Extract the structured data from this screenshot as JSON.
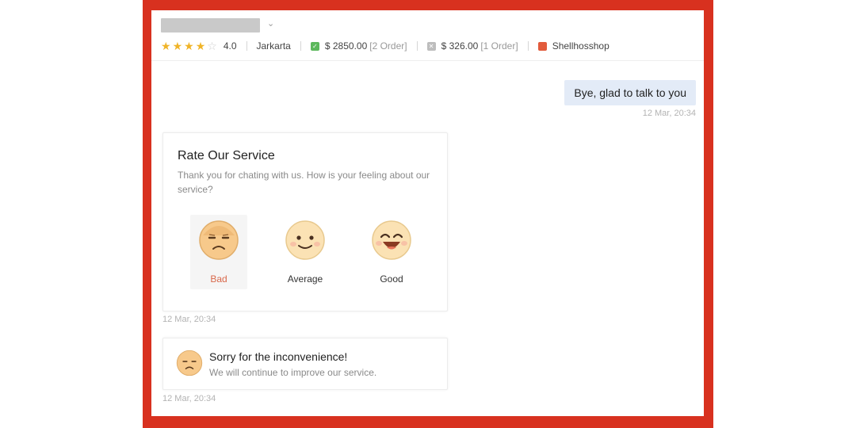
{
  "header": {
    "rating": 4,
    "rating_max": 5,
    "rating_value": "4.0",
    "location": "Jarkarta",
    "paid_amount": "$ 2850.00",
    "paid_orders": "[2 Order]",
    "other_amount": "$ 326.00",
    "other_orders": "[1 Order]",
    "shop_name": "Shellhosshop"
  },
  "chat": {
    "outgoing_message": "Bye, glad to talk to you",
    "outgoing_time": "12 Mar, 20:34",
    "rate_card": {
      "title": "Rate Our Service",
      "subtitle": "Thank you for chating with us. How is your feeling about our service?",
      "options": [
        {
          "label": "Bad",
          "selected": true
        },
        {
          "label": "Average",
          "selected": false
        },
        {
          "label": "Good",
          "selected": false
        }
      ],
      "time": "12 Mar, 20:34"
    },
    "sorry_card": {
      "title": "Sorry for the inconvenience!",
      "subtitle": "We will continue to improve our service.",
      "time": "12 Mar, 20:34"
    }
  },
  "colors": {
    "frame": "#d8311f",
    "star": "#f0b428",
    "bad_selected": "#d9694c",
    "outgoing_bubble": "#e3ebf7"
  },
  "icons": {
    "chevron": "chevron-down-icon",
    "paid": "checkmark-icon",
    "other": "close-icon",
    "shop": "shop-icon"
  }
}
